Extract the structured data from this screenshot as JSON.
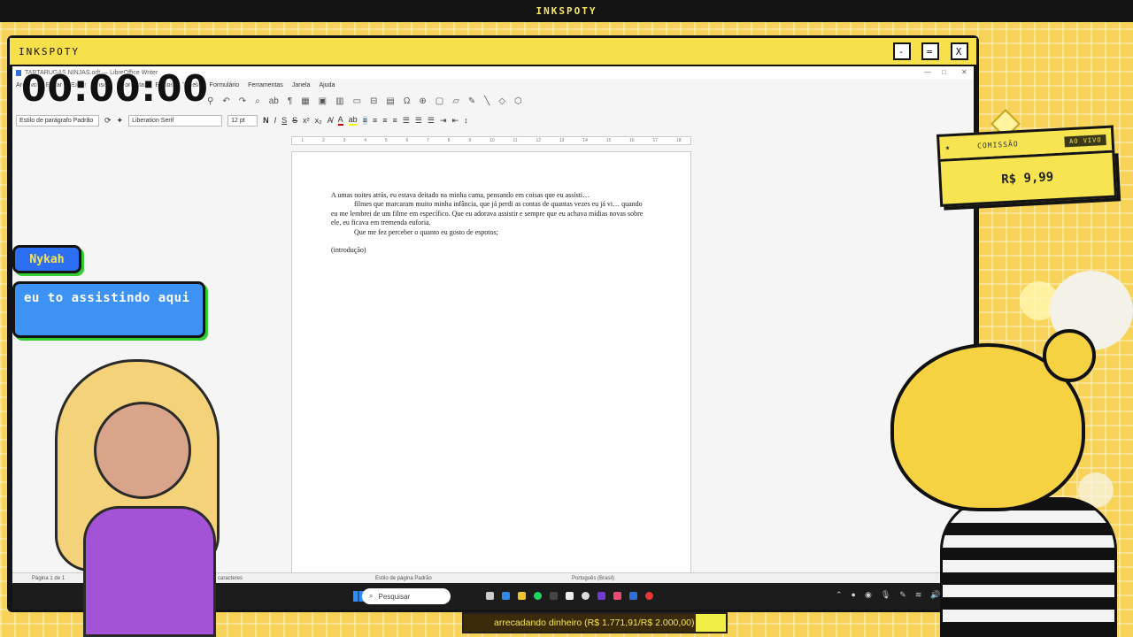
{
  "top_bar": {
    "title": "INKSPOTY"
  },
  "frame": {
    "title": "INKSPOTY",
    "minimize_label": "-",
    "maximize_label": "=",
    "close_label": "X"
  },
  "writer": {
    "window_title": "TARTARUGAS NINJAS.odt — LibreOffice Writer",
    "menu": [
      "Arquivo",
      "Editar",
      "Exibir",
      "Inserir",
      "Formatar",
      "Estilos",
      "Tabela",
      "Formulário",
      "Ferramentas",
      "Janela",
      "Ajuda"
    ],
    "paragraph_style": "Estilo de parágrafo Padrão",
    "font_name": "Liberation Serif",
    "font_size": "12 pt",
    "document": {
      "line1": "A umas noites atrás, eu estava deitado na minha cama, pensando em coisas que eu assisti…",
      "line2": "filmes que marcaram muito minha infância, que já perdi as contas de quantas vezes eu já vi… quando eu me lembrei de um filme em específico. Que eu adorava assistir e sempre que eu achava mídias novas sobre ele, eu ficava em tremenda euforia.",
      "line3": "Que me fez perceber o quanto eu gosto de espotos;",
      "line4": "(introdução)"
    },
    "status": {
      "page": "Página 1 de 1",
      "words": "caracteres",
      "page_style": "Estilo de página Padrão",
      "language": "Português (Brasil)"
    }
  },
  "taskbar": {
    "search_placeholder": "Pesquisar"
  },
  "timer": "00:00:00",
  "chat": {
    "user": "Nykah",
    "message": "eu to assistindo aqui"
  },
  "commission": {
    "label": "COMISSÃO",
    "badge": "AO VIVO",
    "price": "R$ 9,99"
  },
  "goal": {
    "text": "arrecadando dinheiro (R$ 1.771,91/R$ 2.000,00)",
    "raised": 1771.91,
    "target": 2000.0
  },
  "colors": {
    "background": "#f7d35a",
    "accent_yellow": "#f6e04c",
    "chat_blue": "#3d92f5",
    "chat_shadow": "#33cc33"
  }
}
